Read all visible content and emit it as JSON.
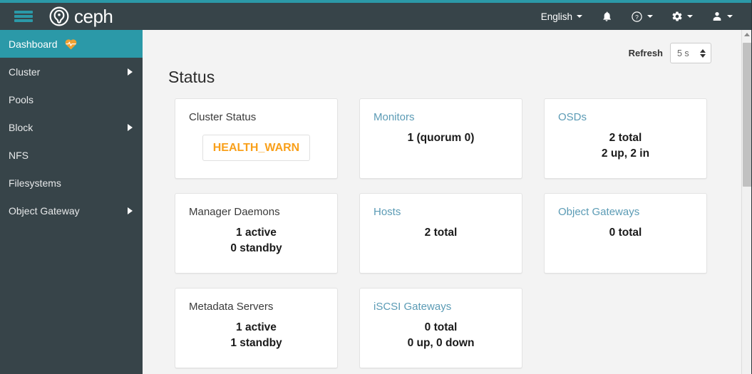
{
  "header": {
    "menu_icon": "hamburger-icon",
    "brand_name": "ceph",
    "brand_icon": "ceph-logo-icon",
    "language": "English",
    "notifications_icon": "bell-icon",
    "help_icon": "question-circle-icon",
    "settings_icon": "gear-icon",
    "user_icon": "user-icon",
    "accent_color": "#2b99a8",
    "background_color": "#374449"
  },
  "sidebar": {
    "active_color": "#2b99a8",
    "items": [
      {
        "label": "Dashboard",
        "active": true,
        "expandable": false,
        "icon": "heartbeat-icon"
      },
      {
        "label": "Cluster",
        "active": false,
        "expandable": true,
        "icon": ""
      },
      {
        "label": "Pools",
        "active": false,
        "expandable": false,
        "icon": ""
      },
      {
        "label": "Block",
        "active": false,
        "expandable": true,
        "icon": ""
      },
      {
        "label": "NFS",
        "active": false,
        "expandable": false,
        "icon": ""
      },
      {
        "label": "Filesystems",
        "active": false,
        "expandable": false,
        "icon": ""
      },
      {
        "label": "Object Gateway",
        "active": false,
        "expandable": true,
        "icon": ""
      }
    ]
  },
  "toolbar": {
    "refresh_label": "Refresh",
    "refresh_value": "5 s"
  },
  "main": {
    "section_title": "Status",
    "cards": [
      {
        "title": "Cluster Status",
        "is_link": false,
        "badge": "HEALTH_WARN",
        "badge_color": "#f9a01b",
        "lines": []
      },
      {
        "title": "Monitors",
        "is_link": true,
        "badge": "",
        "lines": [
          "1 (quorum 0)"
        ]
      },
      {
        "title": "OSDs",
        "is_link": true,
        "badge": "",
        "lines": [
          "2 total",
          "2 up, 2 in"
        ]
      },
      {
        "title": "Manager Daemons",
        "is_link": false,
        "badge": "",
        "lines": [
          "1 active",
          "0 standby"
        ]
      },
      {
        "title": "Hosts",
        "is_link": true,
        "badge": "",
        "lines": [
          "2 total"
        ]
      },
      {
        "title": "Object Gateways",
        "is_link": true,
        "badge": "",
        "lines": [
          "0 total"
        ]
      },
      {
        "title": "Metadata Servers",
        "is_link": false,
        "badge": "",
        "lines": [
          "1 active",
          "1 standby"
        ]
      },
      {
        "title": "iSCSI Gateways",
        "is_link": true,
        "badge": "",
        "lines": [
          "0 total",
          "0 up, 0 down"
        ]
      }
    ]
  }
}
